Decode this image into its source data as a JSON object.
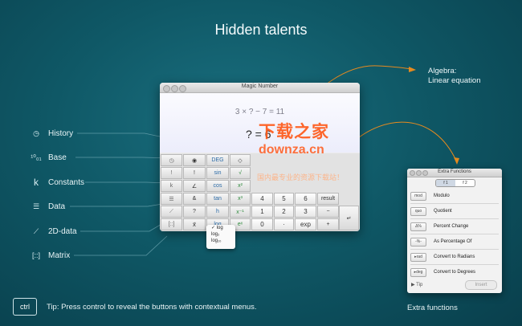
{
  "headline": "Hidden talents",
  "features": [
    {
      "icon": "clock-icon",
      "glyph": "◷",
      "label": "History"
    },
    {
      "icon": "base-icon",
      "glyph": "¹⁰₀₁",
      "label": "Base"
    },
    {
      "icon": "k-constant-icon",
      "glyph": "k",
      "label": "Constants"
    },
    {
      "icon": "list-icon",
      "glyph": "☰",
      "label": "Data"
    },
    {
      "icon": "scatter-icon",
      "glyph": "⟋",
      "label": "2D-data"
    },
    {
      "icon": "matrix-icon",
      "glyph": "[::]",
      "label": "Matrix"
    }
  ],
  "callouts": {
    "algebra_line1": "Algebra:",
    "algebra_line2": "Linear equation"
  },
  "window": {
    "title": "Magic Number",
    "expression": "3 × ? − 7 = 11",
    "answer": "? = 6"
  },
  "keypad": [
    [
      "◷",
      "◉",
      "DEG",
      "◇",
      "",
      "",
      "",
      ""
    ],
    [
      "!",
      "!",
      "sin",
      "√",
      "",
      "",
      "",
      ""
    ],
    [
      "k",
      "∠",
      "cos",
      "x²",
      "",
      "",
      "",
      ""
    ],
    [
      "☰",
      "&",
      "tan",
      "x³",
      "4",
      "5",
      "6",
      "result"
    ],
    [
      "⟋",
      "?",
      "h",
      "x⁻¹",
      "1",
      "2",
      "3",
      "−"
    ],
    [
      "[::]",
      "x⃗",
      "log",
      "eˣ",
      "0",
      "·",
      "exp",
      "+"
    ]
  ],
  "enter_key": "↵",
  "log_menu": [
    "✓ log",
    "log₂",
    "log₁₀"
  ],
  "extra_panel": {
    "title": "Extra Functions",
    "tabs": [
      "f 1",
      "f 2"
    ],
    "rows": [
      {
        "key": "mod",
        "label": "Modulo"
      },
      {
        "key": "quo",
        "label": "Quotient"
      },
      {
        "key": "Δ%",
        "label": "Percent Change"
      },
      {
        "key": "-%-",
        "label": "As Percentage Of"
      },
      {
        "key": "▸rad",
        "label": "Convert to Radians"
      },
      {
        "key": "▸deg",
        "label": "Convert to Degrees"
      }
    ],
    "tip": "▶ Tip",
    "insert": "Insert"
  },
  "ctrl_key": "ctrl",
  "tip_text": "Tip:  Press control to reveal the buttons with contextual menus.",
  "extra_label": "Extra functions",
  "watermark": {
    "line1": "下载之家",
    "line2": "downza.cn",
    "line3": "国内最专业的资源下载站！"
  },
  "colors": {
    "background": "#0f5866",
    "arrow": "#e58a1f",
    "leader_line": "#5e9aa6",
    "watermark": "#ff5a1a"
  }
}
